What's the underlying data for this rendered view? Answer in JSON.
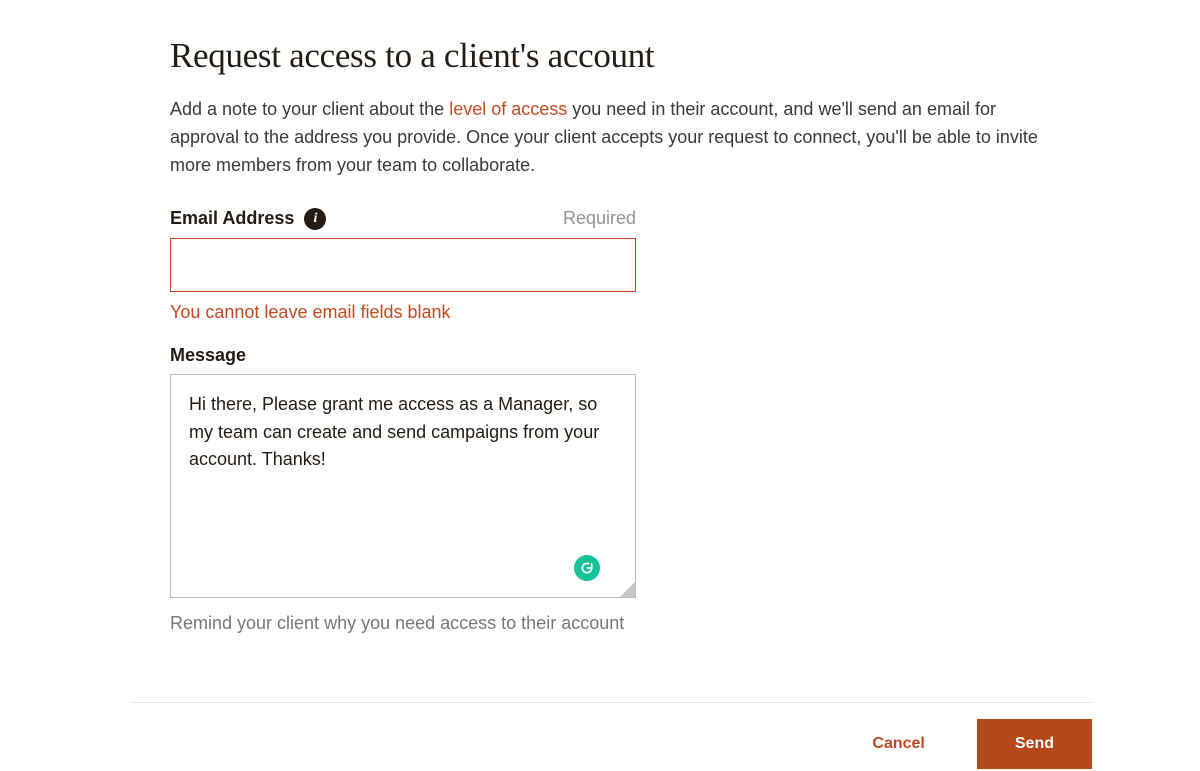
{
  "page": {
    "title": "Request access to a client's account",
    "intro_pre": "Add a note to your client about the ",
    "intro_link": "level of access",
    "intro_post": " you need in their account, and we'll send an email for approval to the address you provide. Once your client accepts your request to connect, you'll be able to invite more members from your team to collaborate."
  },
  "email": {
    "label": "Email Address",
    "required_label": "Required",
    "value": "",
    "error": "You cannot leave email fields blank"
  },
  "message": {
    "label": "Message",
    "value": "Hi there, Please grant me access as a Manager, so my team can create and send campaigns from your account. Thanks!",
    "helper": "Remind your client why you need access to their account"
  },
  "footer": {
    "cancel": "Cancel",
    "send": "Send"
  },
  "icons": {
    "info": "i",
    "grammarly": "G"
  },
  "colors": {
    "accent": "#c24a1e",
    "text": "#241c15",
    "muted": "#959492",
    "border_error": "#c24a1e",
    "border_default": "#bdbbb9",
    "button_primary_bg": "#b3481a"
  }
}
